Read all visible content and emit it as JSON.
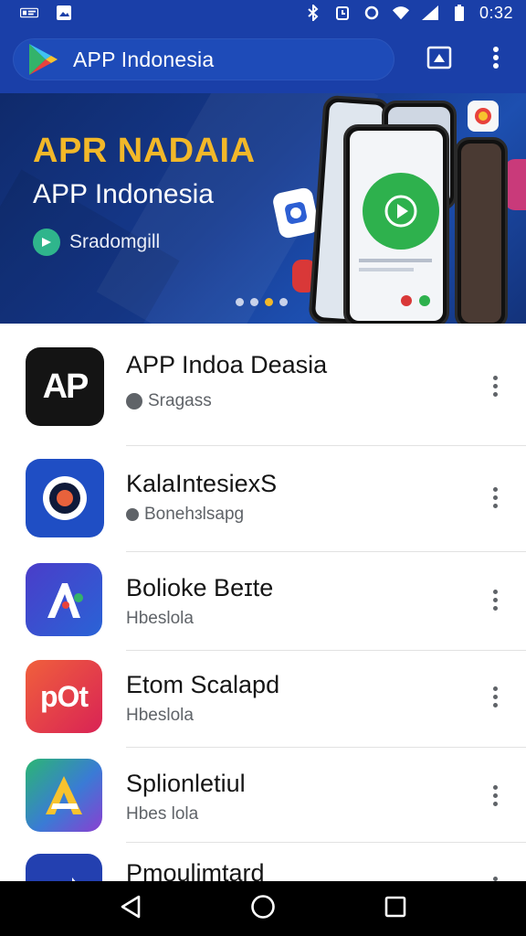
{
  "status_bar": {
    "time": "0:32",
    "left_icons": [
      "gallery-icon",
      "image-icon"
    ],
    "right_icons": [
      "bluetooth-icon",
      "alarm-icon",
      "sync-icon",
      "wifi-icon",
      "signal-icon",
      "battery-icon"
    ]
  },
  "app_bar": {
    "title": "APP Indonesia",
    "icons": [
      "play-store-icon",
      "cast-icon",
      "more-vert-icon"
    ]
  },
  "banner": {
    "headline": "APR NADAIA",
    "subtitle": "APP Indonesia",
    "brand": "Sradomgill",
    "page_indicator": {
      "count": 4,
      "active": 2
    },
    "colors": {
      "headline": "#f2b829",
      "background": "#163a8f"
    }
  },
  "apps": [
    {
      "name": "APP Indoa Deasia",
      "meta": "Sragass",
      "icon_text": "AP",
      "icon": "ap-app-icon"
    },
    {
      "name": "KalaIntesiexS",
      "meta": "Bonehɜlsapg",
      "icon_text": "",
      "icon": "ring-app-icon"
    },
    {
      "name": "Bolioke Beɪte",
      "meta": "Hbeslola",
      "icon_text": "",
      "icon": "letter-a-app-icon"
    },
    {
      "name": "Etom Scalapd",
      "meta": "Hbeslola",
      "icon_text": "pOt",
      "icon": "pot-app-icon"
    },
    {
      "name": "Splionletiul",
      "meta": "Hbes lola",
      "icon_text": "",
      "icon": "gradient-a-app-icon"
    },
    {
      "name": "Pmoulimtard",
      "meta": "",
      "icon_text": "",
      "icon": "arrow-app-icon"
    }
  ],
  "nav_bar": {
    "buttons": [
      "back-icon",
      "home-icon",
      "recents-icon"
    ]
  }
}
